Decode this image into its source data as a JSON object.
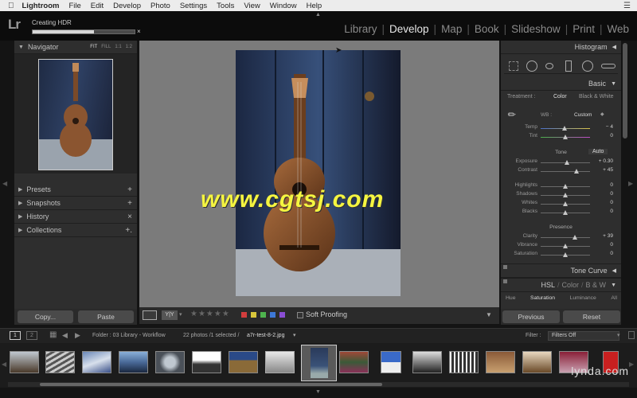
{
  "menubar": {
    "app": "Lightroom",
    "items": [
      "File",
      "Edit",
      "Develop",
      "Photo",
      "Settings",
      "Tools",
      "View",
      "Window",
      "Help"
    ]
  },
  "task": {
    "label": "Creating HDR",
    "progress": 0.6,
    "close": "×"
  },
  "modules": {
    "items": [
      "Library",
      "Develop",
      "Map",
      "Book",
      "Slideshow",
      "Print",
      "Web"
    ],
    "active": "Develop"
  },
  "left": {
    "navigator": {
      "title": "Navigator",
      "opts": [
        "FIT",
        "FILL",
        "1:1",
        "1:2"
      ]
    },
    "panels": [
      {
        "title": "Presets",
        "action": "+"
      },
      {
        "title": "Snapshots",
        "action": "+"
      },
      {
        "title": "History",
        "action": "×"
      },
      {
        "title": "Collections",
        "action": "+."
      }
    ],
    "copy": "Copy...",
    "paste": "Paste"
  },
  "watermark": "www.cgtsj.com",
  "toolbar": {
    "soft_proofing": "Soft Proofing",
    "flag_colors": [
      "#d23d3d",
      "#d8c63b",
      "#4eb34e",
      "#3d78d6",
      "#8a4ed4"
    ]
  },
  "right": {
    "histogram": "Histogram",
    "basic": "Basic",
    "treatment": {
      "label": "Treatment :",
      "color": "Color",
      "bw": "Black & White"
    },
    "wb": {
      "label": "WB :",
      "value": "Custom"
    },
    "temp": {
      "label": "Temp",
      "value": "− 4",
      "pos": 0.48
    },
    "tint": {
      "label": "Tint",
      "value": "0",
      "pos": 0.5
    },
    "tone": "Tone",
    "auto": "Auto",
    "exposure": {
      "label": "Exposure",
      "value": "+ 0.30",
      "pos": 0.53
    },
    "contrast": {
      "label": "Contrast",
      "value": "+ 45",
      "pos": 0.72
    },
    "highlights": {
      "label": "Highlights",
      "value": "0",
      "pos": 0.5
    },
    "shadows": {
      "label": "Shadows",
      "value": "0",
      "pos": 0.5
    },
    "whites": {
      "label": "Whites",
      "value": "0",
      "pos": 0.5
    },
    "blacks": {
      "label": "Blacks",
      "value": "0",
      "pos": 0.5
    },
    "presence": "Presence",
    "clarity": {
      "label": "Clarity",
      "value": "+ 39",
      "pos": 0.69
    },
    "vibrance": {
      "label": "Vibrance",
      "value": "0",
      "pos": 0.5
    },
    "saturation": {
      "label": "Saturation",
      "value": "0",
      "pos": 0.5
    },
    "tone_curve": "Tone Curve",
    "hsl": {
      "hsl": "HSL",
      "color": "Color",
      "bw": "B & W"
    },
    "hsl_tabs": [
      "Hue",
      "Saturation",
      "Luminance",
      "All"
    ],
    "previous": "Previous",
    "reset": "Reset"
  },
  "filmbar": {
    "page1": "1",
    "page2": "2",
    "folder": "Folder : 03 Library - Workflow",
    "count": "22 photos /1 selected /",
    "file": "a7r-test-8-2.jpg",
    "filter_label": "Filter :",
    "filter_value": "Filters Off"
  },
  "lynda": "lynda.com"
}
